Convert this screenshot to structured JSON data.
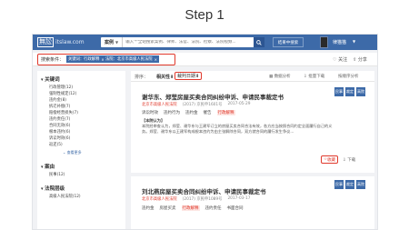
{
  "step_title": "Step 1",
  "topbar": {
    "logo_cn": "無訟",
    "logo_en": "itslaw.com",
    "search_type": "案例",
    "search_placeholder": "输入'*'全站搜索案例、律师、法官、法院、检察、法院视频...",
    "search_icon": "search-icon",
    "advanced_label": "结果中搜索",
    "user_name": "律猫猫"
  },
  "filterbar": {
    "label": "搜索条件：",
    "chips": [
      {
        "text": "关键词：行政解释",
        "close": "×"
      },
      {
        "text": "法院：北京市高级人民法院",
        "close": "×"
      }
    ],
    "follow_label": "关注",
    "share_label": "分享"
  },
  "sidebar": {
    "keyword_head": "关键词",
    "keyword_items": [
      "行政管理(12)",
      "强制性规定(12)",
      "违约金(8)",
      "拆迁补偿(7)",
      "赔偿经营损失(7)",
      "违约责任(7)",
      "合同无效(6)",
      "根本违约(6)",
      "诉讼时效(6)",
      "返还(5)"
    ],
    "more_label": "查看更多",
    "cause_head": "案由",
    "cause_items": [
      "民事(12)"
    ],
    "court_level_head": "法院层级",
    "court_level_items": [
      "高级人民法院(12)"
    ]
  },
  "sortbar": {
    "label": "排序：",
    "relevance": "相关性",
    "date": "裁判日期",
    "tools": [
      "数据分析",
      "批量下载",
      "按顺序分析"
    ]
  },
  "cards": [
    {
      "title": "谢华东、郑莹房屋买卖合同纠纷申诉、申请民事裁定书",
      "court": "北京市高级人民法院",
      "case_no": "(2017) 京民申1601号",
      "date": "2017-05-29",
      "tags": [
        "诉讼时效",
        "违约行为",
        "违约金",
        "催告",
        "行政解释"
      ],
      "highlight_tag": "行政解释",
      "excerpt_head": "【本院认为】",
      "excerpt": "本院经审查认为，郑莹、谢华东与王建军订立的房屋买卖合同合法有效，各方应当按照合同约定全面履行自己的义务。郑莹、谢华东以王建军构成根本违约为由主张解除合同，双方就合同的履行发生争议...",
      "badges": [
        "民事",
        "裁定",
        "高院"
      ],
      "collect_label": "收藏",
      "download_label": "下载"
    },
    {
      "title": "刘北燕房屋买卖合同纠纷申诉、申请民事裁定书",
      "court": "北京市高级人民法院",
      "case_no": "(2017) 京民申1089号",
      "date": "2017-03-17",
      "tags": [
        "违约金",
        "房屋买卖",
        "行政解释",
        "违约责任",
        "书面合同"
      ],
      "highlight_tag": "行政解释",
      "badges": [
        "民事",
        "裁定",
        "高院"
      ]
    }
  ]
}
